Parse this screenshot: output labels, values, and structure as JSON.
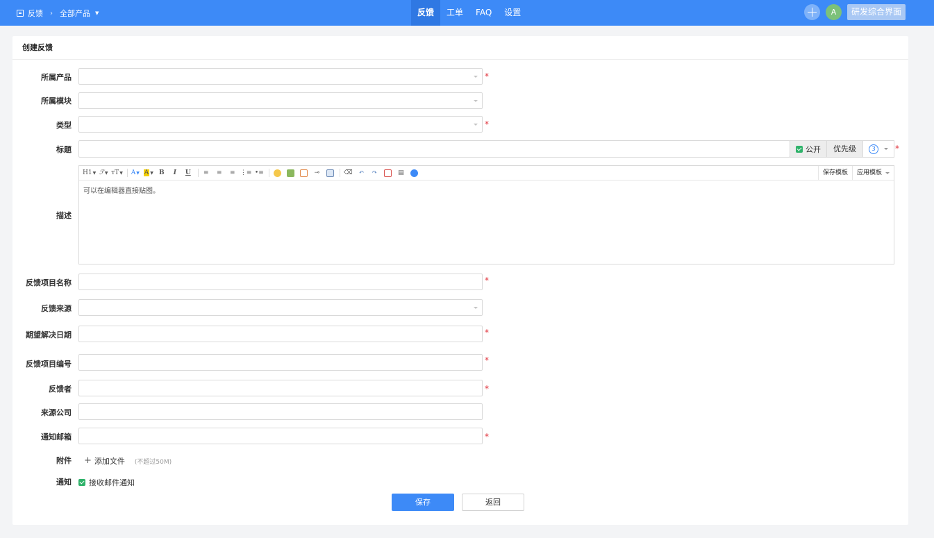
{
  "topbar": {
    "breadcrumb_root": "反馈",
    "breadcrumb_product": "全部产品",
    "nav": [
      "反馈",
      "工单",
      "FAQ",
      "设置"
    ],
    "active_nav": "反馈",
    "avatar_letter": "A",
    "view_button": "研发综合界面"
  },
  "card": {
    "title": "创建反馈"
  },
  "form": {
    "product_label": "所属产品",
    "module_label": "所属模块",
    "type_label": "类型",
    "title_label": "标题",
    "public_label": "公开",
    "priority_label": "优先级",
    "priority_value": "3",
    "desc_label": "描述",
    "editor_placeholder": "可以在编辑器直接贴图。",
    "save_template": "保存模板",
    "apply_template": "应用模板",
    "project_name_label": "反馈项目名称",
    "source_label": "反馈来源",
    "expected_date_label": "期望解决日期",
    "project_no_label": "反馈项目编号",
    "reporter_label": "反馈者",
    "company_label": "来源公司",
    "email_label": "通知邮箱",
    "attach_label": "附件",
    "add_file": "添加文件",
    "file_hint": "(不超过50M)",
    "notify_label": "通知",
    "receive_email": "接收邮件通知",
    "required_mark": "*"
  },
  "buttons": {
    "save": "保存",
    "back": "返回"
  },
  "colors": {
    "accent": "#3d8af7",
    "required": "#e1333c",
    "check": "#2fb26a"
  }
}
